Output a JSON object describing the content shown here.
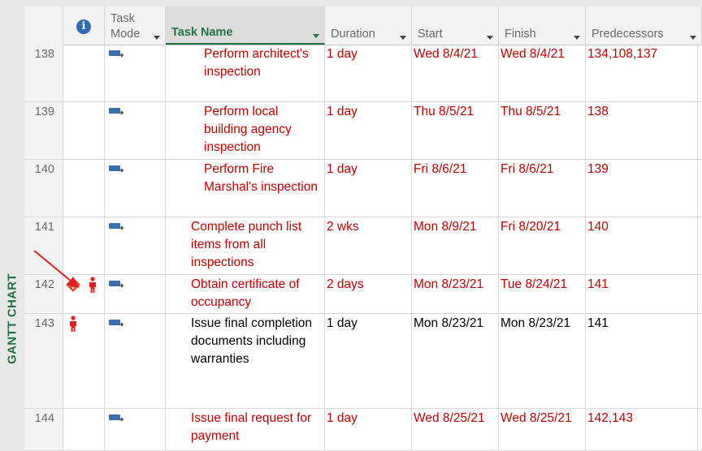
{
  "view": {
    "side_label": "GANTT CHART"
  },
  "columns": {
    "indicators_icon": "info-icon",
    "task_mode": "Task Mode",
    "task_name": "Task Name",
    "duration": "Duration",
    "start": "Start",
    "finish": "Finish",
    "predecessors": "Predecessors"
  },
  "colors": {
    "critical_text": "#c00000",
    "accent_green": "#217346",
    "mode_icon_blue": "#3a6fb0"
  },
  "rows": [
    {
      "id": "138",
      "name": "Perform architect's inspection",
      "duration": "1 day",
      "start": "Wed 8/4/21",
      "finish": "Wed 8/4/21",
      "predecessors": "134,108,137",
      "critical": true,
      "indent": 3,
      "indicators": []
    },
    {
      "id": "139",
      "name": "Perform local building agency inspection",
      "duration": "1 day",
      "start": "Thu 8/5/21",
      "finish": "Thu 8/5/21",
      "predecessors": "138",
      "critical": true,
      "indent": 3,
      "indicators": []
    },
    {
      "id": "140",
      "name": "Perform Fire Marshal's inspection",
      "duration": "1 day",
      "start": "Fri 8/6/21",
      "finish": "Fri 8/6/21",
      "predecessors": "139",
      "critical": true,
      "indent": 3,
      "indicators": []
    },
    {
      "id": "141",
      "name": "Complete punch list items from all inspections",
      "duration": "2 wks",
      "start": "Mon 8/9/21",
      "finish": "Fri 8/20/21",
      "predecessors": "140",
      "critical": true,
      "indent": 2,
      "indicators": []
    },
    {
      "id": "142",
      "name": "Obtain certificate of occupancy",
      "duration": "2 days",
      "start": "Mon 8/23/21",
      "finish": "Tue 8/24/21",
      "predecessors": "141",
      "critical": true,
      "indent": 2,
      "indicators": [
        "warning-icon",
        "resource-person-icon"
      ]
    },
    {
      "id": "143",
      "name": "Issue final completion documents including warranties",
      "duration": "1 day",
      "start": "Mon 8/23/21",
      "finish": "Mon 8/23/21",
      "predecessors": "141",
      "critical": false,
      "indent": 2,
      "indicators": [
        "resource-person-icon"
      ]
    },
    {
      "id": "144",
      "name": "Issue final request for payment",
      "duration": "1 day",
      "start": "Wed 8/25/21",
      "finish": "Wed 8/25/21",
      "predecessors": "142,143",
      "critical": true,
      "indent": 2,
      "indicators": []
    }
  ]
}
